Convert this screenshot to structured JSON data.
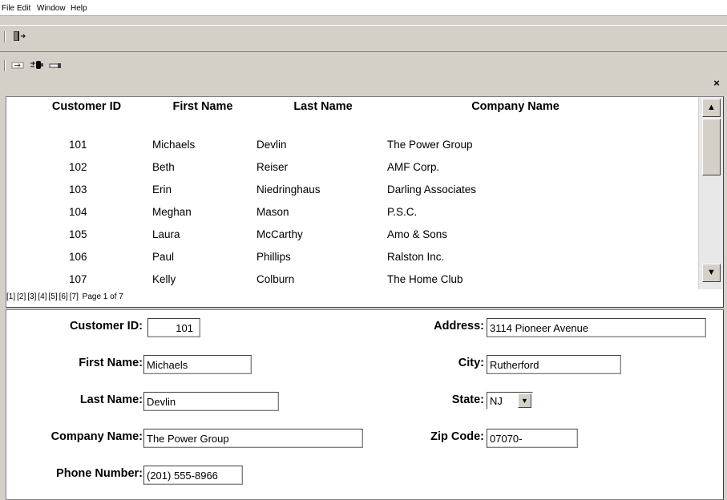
{
  "menu": {
    "file": "File",
    "edit": "Edit",
    "window": "Window",
    "help": "Help"
  },
  "window": {
    "close_glyph": "×"
  },
  "toolbar1": {
    "icons": [
      "exit-door-icon"
    ]
  },
  "toolbar2": {
    "icons": [
      "record-nav-icon",
      "connect-plug-icon",
      "key-icon"
    ]
  },
  "grid": {
    "headers": {
      "customer_id": "Customer ID",
      "first_name": "First Name",
      "last_name": "Last Name",
      "company_name": "Company Name"
    },
    "rows": [
      {
        "id": "101",
        "first": "Michaels",
        "last": "Devlin",
        "company": "The Power Group"
      },
      {
        "id": "102",
        "first": "Beth",
        "last": "Reiser",
        "company": "AMF Corp."
      },
      {
        "id": "103",
        "first": "Erin",
        "last": "Niedringhaus",
        "company": "Darling Associates"
      },
      {
        "id": "104",
        "first": "Meghan",
        "last": "Mason",
        "company": "P.S.C."
      },
      {
        "id": "105",
        "first": "Laura",
        "last": "McCarthy",
        "company": "Amo & Sons"
      },
      {
        "id": "106",
        "first": "Paul",
        "last": "Phillips",
        "company": "Ralston Inc."
      },
      {
        "id": "107",
        "first": "Kelly",
        "last": "Colburn",
        "company": "The Home Club"
      }
    ],
    "pager": {
      "pages": [
        "[1]",
        "[2]",
        "[3]",
        "[4]",
        "[5]",
        "[6]",
        "[7]"
      ],
      "status": "Page 1 of 7"
    },
    "scroll": {
      "up": "▲",
      "down": "▼"
    }
  },
  "form": {
    "customer_id": {
      "label": "Customer ID:",
      "value": "101"
    },
    "first_name": {
      "label": "First Name:",
      "value": "Michaels"
    },
    "last_name": {
      "label": "Last Name:",
      "value": "Devlin"
    },
    "company_name": {
      "label": "Company Name:",
      "value": "The Power Group"
    },
    "phone": {
      "label": "Phone Number:",
      "value": "(201) 555-8966"
    },
    "address": {
      "label": "Address:",
      "value": "3114 Pioneer Avenue"
    },
    "city": {
      "label": "City:",
      "value": "Rutherford"
    },
    "state": {
      "label": "State:",
      "value": "NJ",
      "arrow": "▼"
    },
    "zip": {
      "label": "Zip Code:",
      "value": "07070-"
    }
  }
}
